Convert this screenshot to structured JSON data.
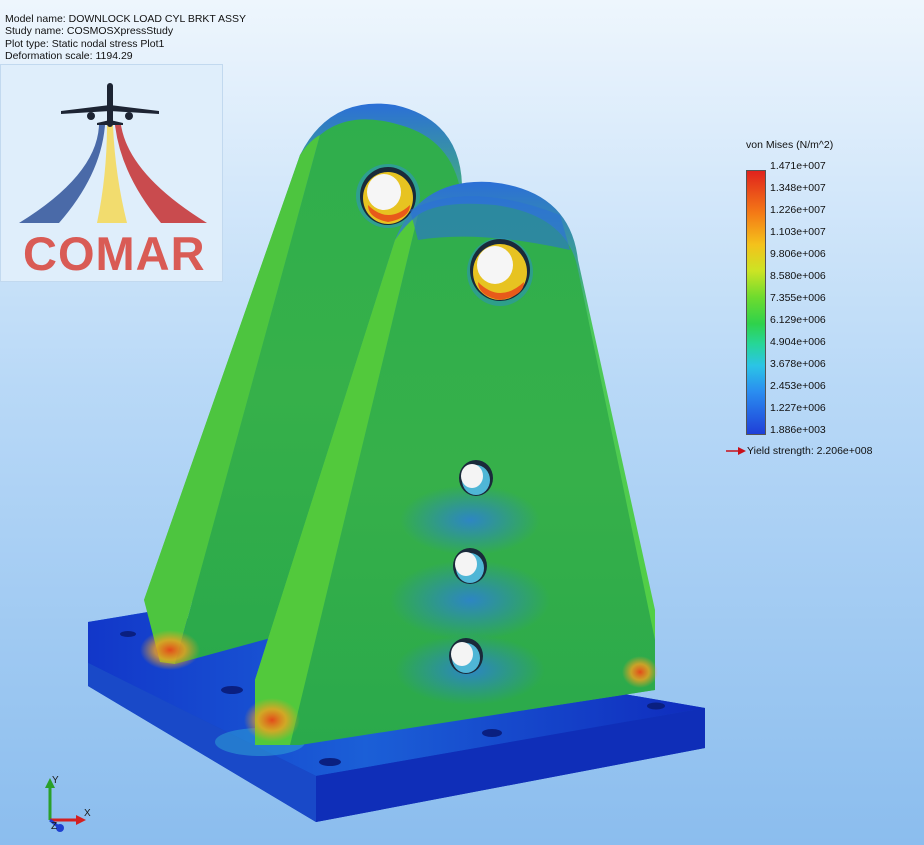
{
  "info": {
    "model_name": "Model name: DOWNLOCK LOAD CYL BRKT ASSY",
    "study_name": "Study name: COSMOSXpressStudy",
    "plot_type": "Plot type: Static nodal stress Plot1",
    "deformation_scale": "Deformation scale: 1194.29"
  },
  "logo": {
    "text": "COMAR",
    "text_color": "#d95b55"
  },
  "legend": {
    "title": "von Mises (N/m^2)",
    "values": [
      "1.471e+007",
      "1.348e+007",
      "1.226e+007",
      "1.103e+007",
      "9.806e+006",
      "8.580e+006",
      "7.355e+006",
      "6.129e+006",
      "4.904e+006",
      "3.678e+006",
      "2.453e+006",
      "1.227e+006",
      "1.886e+003"
    ],
    "yield": "Yield strength: 2.206e+008",
    "yield_arrow_color": "#c8101a"
  },
  "triad": {
    "x": "X",
    "y": "Y",
    "z": "Z"
  }
}
